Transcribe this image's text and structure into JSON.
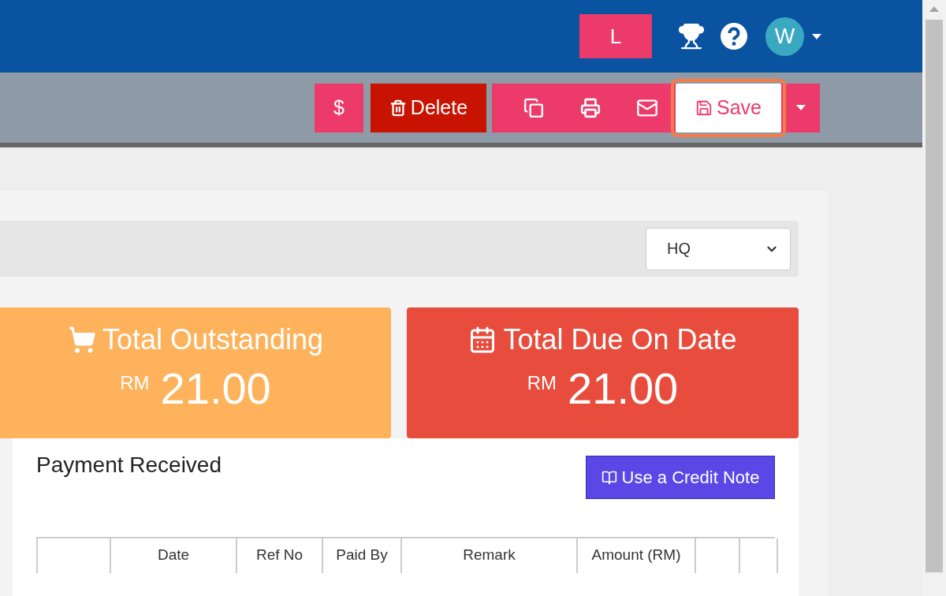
{
  "topbar": {
    "user_badge": "L",
    "avatar": "W"
  },
  "toolbar": {
    "buttons": [
      {
        "kind": "payment",
        "label": "$"
      },
      {
        "kind": "delete",
        "label": "Delete"
      },
      {
        "kind": "duplicate"
      },
      {
        "kind": "print"
      },
      {
        "kind": "email"
      },
      {
        "kind": "save",
        "label": "Save",
        "highlighted": true
      },
      {
        "kind": "more"
      }
    ]
  },
  "filter": {
    "branch_select": "HQ"
  },
  "tiles": [
    {
      "kind": "outstanding",
      "title": "Total Outstanding",
      "currency": "RM",
      "amount": "21.00",
      "color": "#fdb25b"
    },
    {
      "kind": "due",
      "title": "Total Due On Date",
      "currency": "RM",
      "amount": "21.00",
      "color": "#e74c3c"
    }
  ],
  "payments": {
    "title": "Payment Received",
    "credit_button": "Use a Credit Note",
    "columns": [
      {
        "kind": "blank"
      },
      {
        "kind": "text",
        "label": "Date"
      },
      {
        "kind": "text",
        "label": "Ref No"
      },
      {
        "kind": "text",
        "label": "Paid By"
      },
      {
        "kind": "text",
        "label": "Remark"
      },
      {
        "kind": "text",
        "label": "Amount (RM)"
      },
      {
        "kind": "blank"
      },
      {
        "kind": "blank"
      }
    ]
  }
}
